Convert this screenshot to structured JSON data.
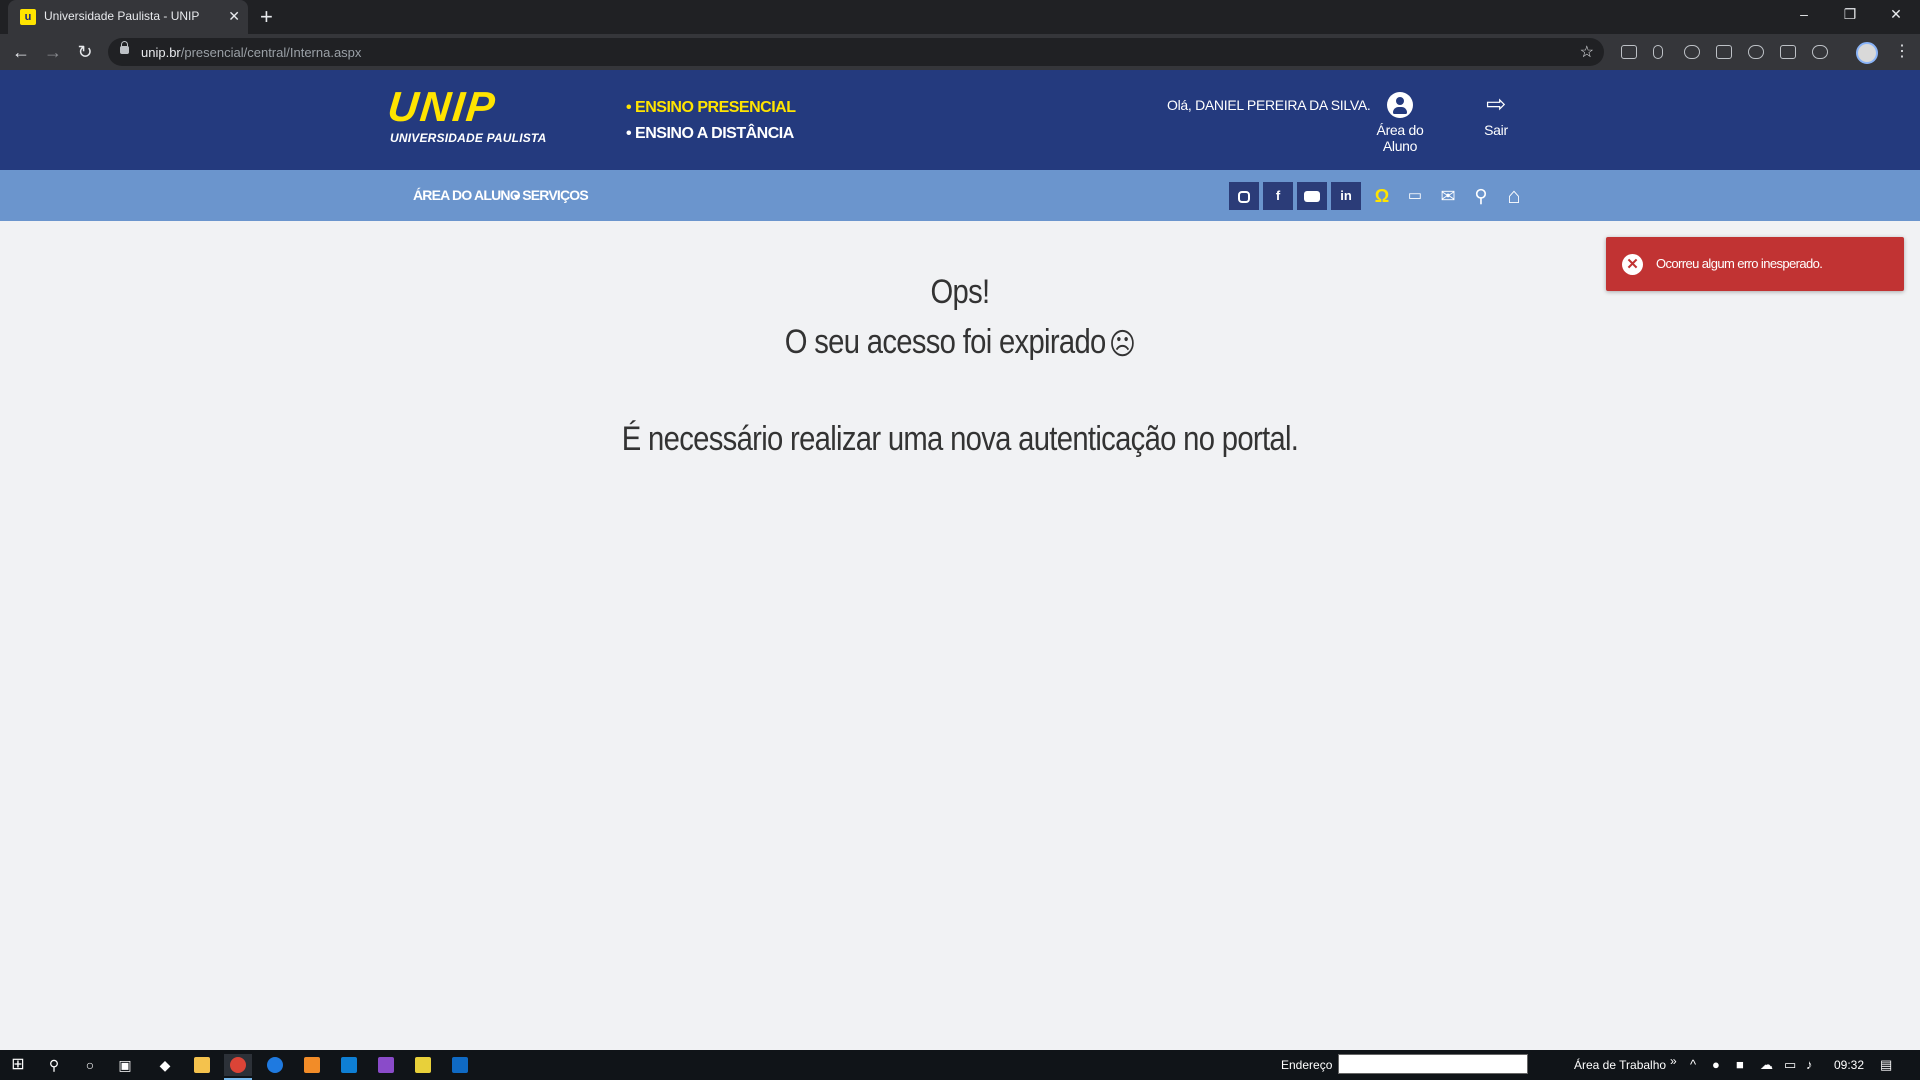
{
  "browser": {
    "tab_title": "Universidade Paulista - UNIP",
    "tab_close": "✕",
    "new_tab": "+",
    "url_host": "unip.br",
    "url_path": "/presencial/central/Interna.aspx",
    "window_controls": [
      "–",
      "❐",
      "✕"
    ],
    "nav": {
      "back": "←",
      "forward": "→",
      "reload": "↻"
    },
    "star": "☆",
    "menu": "⋮"
  },
  "header": {
    "logo_text": "UNIP",
    "logo_subtitle": "UNIVERSIDADE PAULISTA",
    "modes": [
      {
        "label": "• ENSINO PRESENCIAL",
        "active": true
      },
      {
        "label": "• ENSINO A DISTÂNCIA",
        "active": false
      }
    ],
    "greeting": "Olá, DANIEL PEREIRA DA SILVA.",
    "student_area_label": "Área do Aluno",
    "logout_label": "Sair"
  },
  "navbar": {
    "links": [
      {
        "label": "ÁREA DO ALUNO"
      },
      {
        "label": "SERVIÇOS",
        "caret": "▾"
      }
    ],
    "social": [
      {
        "name": "instagram-icon",
        "glyph": ""
      },
      {
        "name": "facebook-icon",
        "glyph": "f"
      },
      {
        "name": "youtube-icon",
        "glyph": ""
      },
      {
        "name": "linkedin-icon",
        "glyph": "in"
      }
    ],
    "tools": [
      {
        "name": "headset-icon",
        "glyph": "Ω"
      },
      {
        "name": "tv-icon",
        "glyph": "📺"
      },
      {
        "name": "mail-icon",
        "glyph": "✉"
      },
      {
        "name": "search-icon",
        "glyph": "⚲"
      },
      {
        "name": "home-icon",
        "glyph": "⌂"
      }
    ]
  },
  "main": {
    "heading": "Ops!",
    "expired_message": "O seu acesso foi expirado",
    "frown": "☹",
    "reauth_message": "É necessário realizar uma nova autenticação no portal."
  },
  "toast": {
    "icon": "✕",
    "message": "Ocorreu algum erro inesperado.",
    "color": "#c13333"
  },
  "taskbar": {
    "address_label": "Endereço",
    "desktop_label": "Área de Trabalho",
    "more": "»",
    "time": "09:32"
  },
  "colors": {
    "header_bg": "#243a7e",
    "navbar_bg": "#6b95cd",
    "accent_yellow": "#ffe400",
    "page_bg": "#f1f2f4"
  }
}
